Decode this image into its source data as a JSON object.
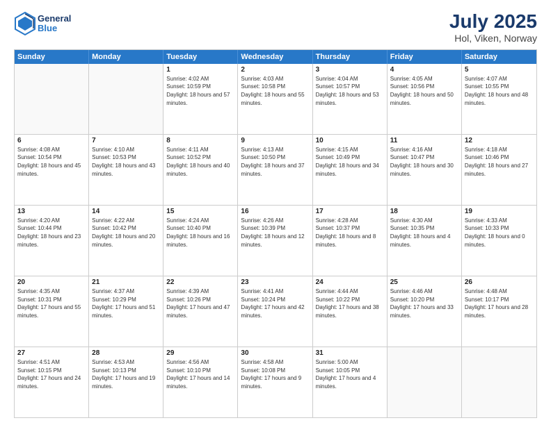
{
  "header": {
    "logo": {
      "general": "General",
      "blue": "Blue"
    },
    "title": "July 2025",
    "location": "Hol, Viken, Norway"
  },
  "calendar": {
    "days_of_week": [
      "Sunday",
      "Monday",
      "Tuesday",
      "Wednesday",
      "Thursday",
      "Friday",
      "Saturday"
    ],
    "weeks": [
      [
        {
          "day": "",
          "empty": true
        },
        {
          "day": "",
          "empty": true
        },
        {
          "day": "1",
          "sunrise": "Sunrise: 4:02 AM",
          "sunset": "Sunset: 10:59 PM",
          "daylight": "Daylight: 18 hours and 57 minutes."
        },
        {
          "day": "2",
          "sunrise": "Sunrise: 4:03 AM",
          "sunset": "Sunset: 10:58 PM",
          "daylight": "Daylight: 18 hours and 55 minutes."
        },
        {
          "day": "3",
          "sunrise": "Sunrise: 4:04 AM",
          "sunset": "Sunset: 10:57 PM",
          "daylight": "Daylight: 18 hours and 53 minutes."
        },
        {
          "day": "4",
          "sunrise": "Sunrise: 4:05 AM",
          "sunset": "Sunset: 10:56 PM",
          "daylight": "Daylight: 18 hours and 50 minutes."
        },
        {
          "day": "5",
          "sunrise": "Sunrise: 4:07 AM",
          "sunset": "Sunset: 10:55 PM",
          "daylight": "Daylight: 18 hours and 48 minutes."
        }
      ],
      [
        {
          "day": "6",
          "sunrise": "Sunrise: 4:08 AM",
          "sunset": "Sunset: 10:54 PM",
          "daylight": "Daylight: 18 hours and 45 minutes."
        },
        {
          "day": "7",
          "sunrise": "Sunrise: 4:10 AM",
          "sunset": "Sunset: 10:53 PM",
          "daylight": "Daylight: 18 hours and 43 minutes."
        },
        {
          "day": "8",
          "sunrise": "Sunrise: 4:11 AM",
          "sunset": "Sunset: 10:52 PM",
          "daylight": "Daylight: 18 hours and 40 minutes."
        },
        {
          "day": "9",
          "sunrise": "Sunrise: 4:13 AM",
          "sunset": "Sunset: 10:50 PM",
          "daylight": "Daylight: 18 hours and 37 minutes."
        },
        {
          "day": "10",
          "sunrise": "Sunrise: 4:15 AM",
          "sunset": "Sunset: 10:49 PM",
          "daylight": "Daylight: 18 hours and 34 minutes."
        },
        {
          "day": "11",
          "sunrise": "Sunrise: 4:16 AM",
          "sunset": "Sunset: 10:47 PM",
          "daylight": "Daylight: 18 hours and 30 minutes."
        },
        {
          "day": "12",
          "sunrise": "Sunrise: 4:18 AM",
          "sunset": "Sunset: 10:46 PM",
          "daylight": "Daylight: 18 hours and 27 minutes."
        }
      ],
      [
        {
          "day": "13",
          "sunrise": "Sunrise: 4:20 AM",
          "sunset": "Sunset: 10:44 PM",
          "daylight": "Daylight: 18 hours and 23 minutes."
        },
        {
          "day": "14",
          "sunrise": "Sunrise: 4:22 AM",
          "sunset": "Sunset: 10:42 PM",
          "daylight": "Daylight: 18 hours and 20 minutes."
        },
        {
          "day": "15",
          "sunrise": "Sunrise: 4:24 AM",
          "sunset": "Sunset: 10:40 PM",
          "daylight": "Daylight: 18 hours and 16 minutes."
        },
        {
          "day": "16",
          "sunrise": "Sunrise: 4:26 AM",
          "sunset": "Sunset: 10:39 PM",
          "daylight": "Daylight: 18 hours and 12 minutes."
        },
        {
          "day": "17",
          "sunrise": "Sunrise: 4:28 AM",
          "sunset": "Sunset: 10:37 PM",
          "daylight": "Daylight: 18 hours and 8 minutes."
        },
        {
          "day": "18",
          "sunrise": "Sunrise: 4:30 AM",
          "sunset": "Sunset: 10:35 PM",
          "daylight": "Daylight: 18 hours and 4 minutes."
        },
        {
          "day": "19",
          "sunrise": "Sunrise: 4:33 AM",
          "sunset": "Sunset: 10:33 PM",
          "daylight": "Daylight: 18 hours and 0 minutes."
        }
      ],
      [
        {
          "day": "20",
          "sunrise": "Sunrise: 4:35 AM",
          "sunset": "Sunset: 10:31 PM",
          "daylight": "Daylight: 17 hours and 55 minutes."
        },
        {
          "day": "21",
          "sunrise": "Sunrise: 4:37 AM",
          "sunset": "Sunset: 10:29 PM",
          "daylight": "Daylight: 17 hours and 51 minutes."
        },
        {
          "day": "22",
          "sunrise": "Sunrise: 4:39 AM",
          "sunset": "Sunset: 10:26 PM",
          "daylight": "Daylight: 17 hours and 47 minutes."
        },
        {
          "day": "23",
          "sunrise": "Sunrise: 4:41 AM",
          "sunset": "Sunset: 10:24 PM",
          "daylight": "Daylight: 17 hours and 42 minutes."
        },
        {
          "day": "24",
          "sunrise": "Sunrise: 4:44 AM",
          "sunset": "Sunset: 10:22 PM",
          "daylight": "Daylight: 17 hours and 38 minutes."
        },
        {
          "day": "25",
          "sunrise": "Sunrise: 4:46 AM",
          "sunset": "Sunset: 10:20 PM",
          "daylight": "Daylight: 17 hours and 33 minutes."
        },
        {
          "day": "26",
          "sunrise": "Sunrise: 4:48 AM",
          "sunset": "Sunset: 10:17 PM",
          "daylight": "Daylight: 17 hours and 28 minutes."
        }
      ],
      [
        {
          "day": "27",
          "sunrise": "Sunrise: 4:51 AM",
          "sunset": "Sunset: 10:15 PM",
          "daylight": "Daylight: 17 hours and 24 minutes."
        },
        {
          "day": "28",
          "sunrise": "Sunrise: 4:53 AM",
          "sunset": "Sunset: 10:13 PM",
          "daylight": "Daylight: 17 hours and 19 minutes."
        },
        {
          "day": "29",
          "sunrise": "Sunrise: 4:56 AM",
          "sunset": "Sunset: 10:10 PM",
          "daylight": "Daylight: 17 hours and 14 minutes."
        },
        {
          "day": "30",
          "sunrise": "Sunrise: 4:58 AM",
          "sunset": "Sunset: 10:08 PM",
          "daylight": "Daylight: 17 hours and 9 minutes."
        },
        {
          "day": "31",
          "sunrise": "Sunrise: 5:00 AM",
          "sunset": "Sunset: 10:05 PM",
          "daylight": "Daylight: 17 hours and 4 minutes."
        },
        {
          "day": "",
          "empty": true
        },
        {
          "day": "",
          "empty": true
        }
      ]
    ]
  }
}
